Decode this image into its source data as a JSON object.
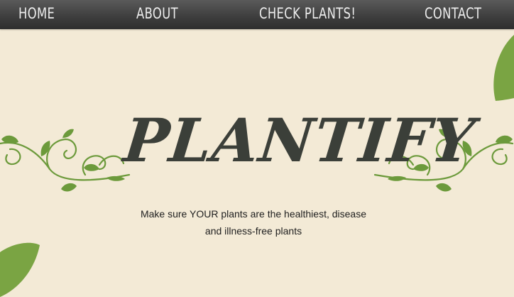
{
  "nav": {
    "home": "HOME",
    "about": "ABOUT",
    "check_plants": "CHECK PLANTS!",
    "contact": "CONTACT"
  },
  "hero": {
    "logo_text": "PLANTIFY",
    "tagline_line1": "Make sure YOUR plants are the healthiest, disease",
    "tagline_line2": "and illness-free plants"
  },
  "colors": {
    "background": "#f3ead6",
    "navbar": "#3f3f3f",
    "nav_text": "#ececec",
    "logo": "#3b3f39",
    "leaf_green": "#7aa443",
    "vine_green": "#6c9a3b"
  },
  "icons": {
    "left_vine": "leafy-vine-ornament-icon",
    "right_vine": "leafy-vine-ornament-icon",
    "top_right_leaf": "leaf-icon",
    "bottom_left_leaf": "leaf-icon"
  }
}
